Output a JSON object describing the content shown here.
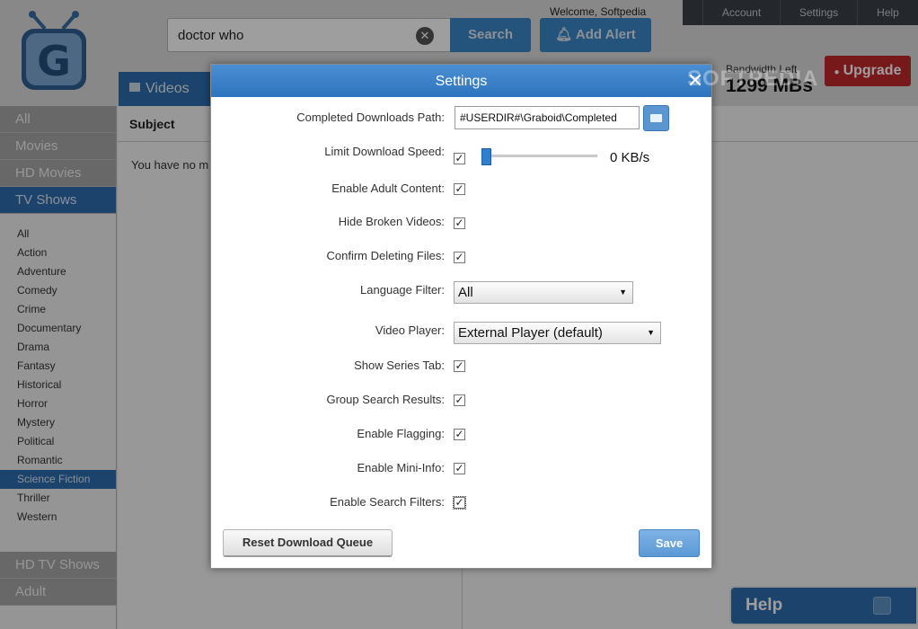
{
  "header": {
    "search_value": "doctor who",
    "search_button": "Search",
    "alert_button": "Add Alert",
    "welcome": "Welcome, Softpedia",
    "nav": [
      "Account",
      "Settings",
      "Help"
    ],
    "bandwidth_label": "Bandwidth Left",
    "bandwidth_value": "1299 MBs",
    "upgrade_button": "Upgrade"
  },
  "videos_tab": "Videos",
  "sidebar": {
    "categories": [
      "All",
      "Movies",
      "HD Movies",
      "TV Shows"
    ],
    "genres": [
      "All",
      "Action",
      "Adventure",
      "Comedy",
      "Crime",
      "Documentary",
      "Drama",
      "Fantasy",
      "Historical",
      "Horror",
      "Mystery",
      "Political",
      "Romantic",
      "Science Fiction",
      "Thriller",
      "Western"
    ],
    "bottom_categories": [
      "HD TV Shows",
      "Adult"
    ]
  },
  "main": {
    "subject_header": "Subject",
    "empty_message": "You have no m"
  },
  "help_button": "Help",
  "settings": {
    "title": "Settings",
    "watermark": "SOFTPEDIA",
    "completed_path_label": "Completed Downloads Path:",
    "completed_path_value": "#USERDIR#\\Graboid\\Completed",
    "limit_speed_label": "Limit Download Speed:",
    "speed_value": "0 KB/s",
    "adult_label": "Enable Adult Content:",
    "hide_broken_label": "Hide Broken Videos:",
    "confirm_delete_label": "Confirm Deleting Files:",
    "language_label": "Language Filter:",
    "language_value": "All",
    "player_label": "Video Player:",
    "player_value": "External Player (default)",
    "series_tab_label": "Show Series Tab:",
    "group_results_label": "Group Search Results:",
    "flagging_label": "Enable Flagging:",
    "mini_info_label": "Enable Mini-Info:",
    "search_filters_label": "Enable Search Filters:",
    "reset_button": "Reset Download Queue",
    "save_button": "Save"
  },
  "colors": {
    "accent": "#2d6cae",
    "upgrade": "#c1272d"
  }
}
